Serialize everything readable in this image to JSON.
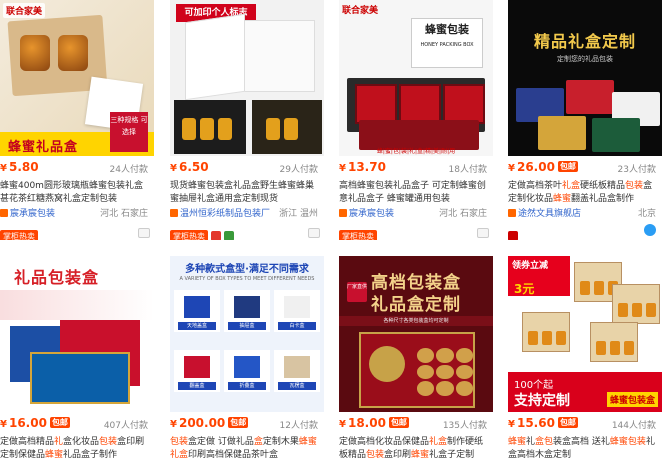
{
  "currency": "¥",
  "products": [
    {
      "price": "5.80",
      "sold": "24人付款",
      "title_parts": [
        {
          "t": "蜂蜜400m圆形玻璃瓶蜂蜜包装礼盒甚花茶红糖燕窝礼盒定制包装"
        }
      ],
      "shop": "宸承宸包装",
      "location": "河北 石家庄",
      "feature": "掌柜热卖",
      "image": {
        "brand": "联合家美",
        "banner": "蜂蜜礼品盒",
        "redtag": "三种规格 可选择"
      }
    },
    {
      "price": "6.50",
      "sold": "29人付款",
      "title_parts": [
        {
          "t": "现货蜂蜜包装盒礼品盒野生蜂蜜蜂巢蜜抽屉礼盒通用盒定制现货"
        }
      ],
      "shop": "温州恒彩纸制品包装厂",
      "location": "浙江 温州",
      "feature": "掌柜热卖",
      "image": {
        "banner": "可加印个人标志"
      }
    },
    {
      "price": "13.70",
      "sold": "18人付款",
      "title_parts": [
        {
          "t": "高档蜂蜜包装礼品盒子 可定制蜂蜜创意礼品盒子 蜂蜜罐通用包装"
        }
      ],
      "shop": "宸承宸包装",
      "location": "河北 石家庄",
      "feature": "掌柜热卖",
      "image": {
        "brand": "联合家美",
        "lid": "蜂蜜包装",
        "lid_sub": "HONEY PACKING BOX",
        "tags": "蜂|蜜|包|装|礼|盒|精|美|耐|用"
      }
    },
    {
      "price": "26.00",
      "badge": "包邮",
      "sold": "23人付款",
      "title_parts": [
        {
          "t": "定做高档茶叶"
        },
        {
          "t": "礼盒",
          "hl": true
        },
        {
          "t": "硬纸板精品"
        },
        {
          "t": "包装",
          "hl": true
        },
        {
          "t": "盒定制化妆品"
        },
        {
          "t": "蜂蜜",
          "hl": true
        },
        {
          "t": "翻盖礼品盒制作"
        }
      ],
      "shop": "途然文具旗舰店",
      "location": "北京",
      "feature": "",
      "image": {
        "title": "精品礼盒定制",
        "sub": "定制您的礼品包装"
      }
    },
    {
      "price": "16.00",
      "badge": "包邮",
      "sold": "407人付款",
      "title_parts": [
        {
          "t": "定做高档精品"
        },
        {
          "t": "礼",
          "hl": true
        },
        {
          "t": "盒化妆品"
        },
        {
          "t": "包装",
          "hl": true
        },
        {
          "t": "盒印刷定制保健品"
        },
        {
          "t": "蜂蜜",
          "hl": true
        },
        {
          "t": "礼品盒子制作"
        }
      ],
      "shop": "",
      "location": "",
      "feature": "",
      "image": {
        "title": "礼品包装盒"
      }
    },
    {
      "price": "200.00",
      "badge": "包邮",
      "sold": "12人付款",
      "title_parts": [
        {
          "t": "包装",
          "hl": true
        },
        {
          "t": "盒定做 订做礼品"
        },
        {
          "t": "盒",
          "hl": true
        },
        {
          "t": "定制木果"
        },
        {
          "t": "蜂蜜",
          "hl": true
        },
        {
          "t": "礼盒",
          "hl": true
        },
        {
          "t": "印刷高档保健品茶叶盒"
        }
      ],
      "shop": "",
      "location": "",
      "feature": "",
      "image": {
        "head": "多种款式盒型·满足不同需求",
        "sub": "A VARIETY OF BOX TYPES TO MEET DIFFERENT NEEDS",
        "cells": [
          "天地盖盒",
          "抽屉盒",
          "白卡盒",
          "翻盖盒",
          "折叠盒",
          "瓦楞盒"
        ]
      }
    },
    {
      "price": "18.00",
      "badge": "包邮",
      "sold": "135人付款",
      "title_parts": [
        {
          "t": "定做高档化妆品保健品"
        },
        {
          "t": "礼盒",
          "hl": true
        },
        {
          "t": "制作硬纸板精品"
        },
        {
          "t": "包装",
          "hl": true
        },
        {
          "t": "盒印刷"
        },
        {
          "t": "蜂蜜",
          "hl": true
        },
        {
          "t": "礼盒子定制"
        }
      ],
      "shop": "",
      "location": "",
      "feature": "",
      "image": {
        "t1": "高档包装盒",
        "t2": "礼品盒定制",
        "badge": "厂家直供",
        "strip": "各种尺寸各类包装盒均可定制"
      }
    },
    {
      "price": "15.60",
      "badge": "包邮",
      "sold": "144人付款",
      "title_parts": [
        {
          "t": "蜂蜜",
          "hl": true
        },
        {
          "t": "礼"
        },
        {
          "t": "盒包",
          "hl": true
        },
        {
          "t": "装盒高档 送礼"
        },
        {
          "t": "蜂蜜包装",
          "hl": true
        },
        {
          "t": "礼盒高档木盒定制"
        }
      ],
      "shop": "",
      "location": "",
      "feature": "",
      "image": {
        "a": "领券立减",
        "b": "3元",
        "c1": "100个起",
        "c2": "支持定制",
        "c3": "蜂蜜包装盒"
      }
    }
  ]
}
